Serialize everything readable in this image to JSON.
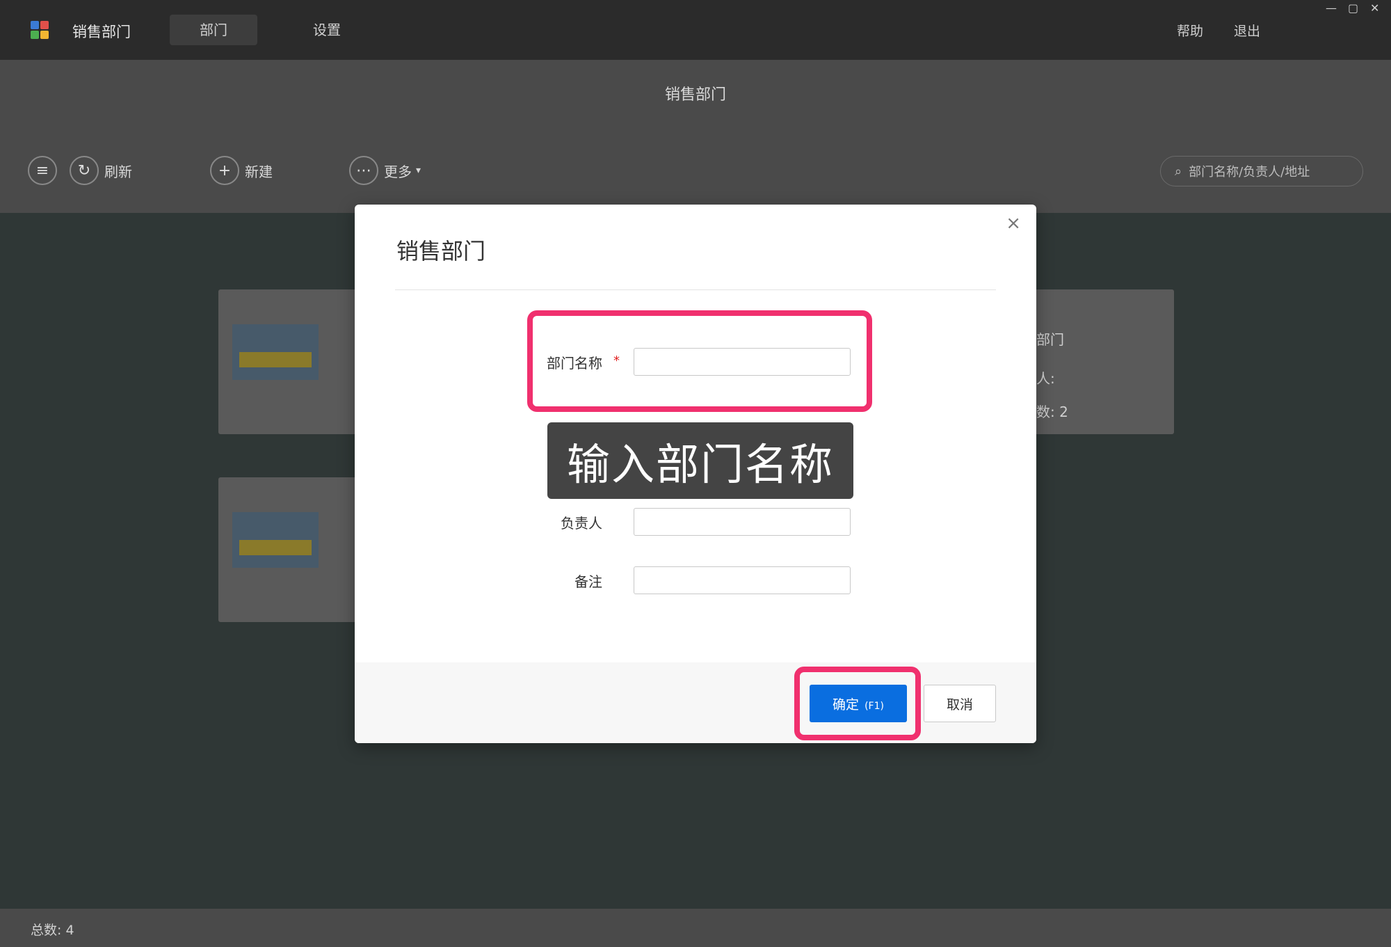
{
  "app": {
    "title": "销售部门",
    "nav_tabs": [
      {
        "label": "部门",
        "active": true
      },
      {
        "label": "设置",
        "active": false
      }
    ],
    "top_right_links": [
      "帮助",
      "退出"
    ],
    "window_controls": [
      "—",
      "▢",
      "✕"
    ]
  },
  "page": {
    "title": "销售部门",
    "toolbar": {
      "menu_icon": "list-icon",
      "refresh_label": "刷新",
      "new_label": "新建",
      "more_label": "更多"
    },
    "search_placeholder": "部门名称/负责人/地址"
  },
  "cards_right_text": [
    "部门",
    "人:",
    "数: 2"
  ],
  "footer": {
    "total_label": "总数: 4"
  },
  "modal": {
    "title": "销售部门",
    "close_label": "×",
    "fields": [
      {
        "label": "部门名称",
        "required": true,
        "value": ""
      },
      {
        "label": "负责人",
        "required": false,
        "value": ""
      },
      {
        "label": "备注",
        "required": false,
        "value": ""
      }
    ],
    "required_mark": "*",
    "confirm_label": "确定",
    "confirm_shortcut": "(F1)",
    "cancel_label": "取消"
  },
  "overlay": {
    "caption": "输入部门名称",
    "highlight_color": "#f0306e"
  },
  "colors": {
    "primary": "#0a6ee0",
    "required": "#e02020"
  }
}
